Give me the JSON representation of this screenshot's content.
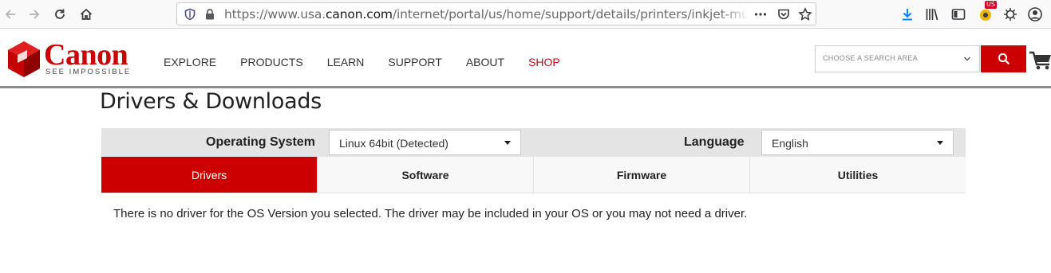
{
  "browser": {
    "url_prefix": "https://www.usa.",
    "url_host": "canon.com",
    "url_path": "/internet/portal/us/home/support/details/printers/inkjet-multifu",
    "extension_badge": "US"
  },
  "header": {
    "brand": "Canon",
    "tagline": "SEE IMPOSSIBLE",
    "nav": [
      "EXPLORE",
      "PRODUCTS",
      "LEARN",
      "SUPPORT",
      "ABOUT",
      "SHOP"
    ],
    "search_placeholder": "CHOOSE A SEARCH AREA"
  },
  "content": {
    "title": "Drivers & Downloads",
    "os_label": "Operating System",
    "os_value": "Linux 64bit (Detected)",
    "language_label": "Language",
    "language_value": "English",
    "tabs": [
      "Drivers",
      "Software",
      "Firmware",
      "Utilities"
    ],
    "active_tab": "Drivers",
    "message": "There is no driver for the OS Version you selected. The driver may be included in your OS or you may not need a driver."
  },
  "colors": {
    "accent": "#cc0000",
    "shop": "#b5121b"
  }
}
